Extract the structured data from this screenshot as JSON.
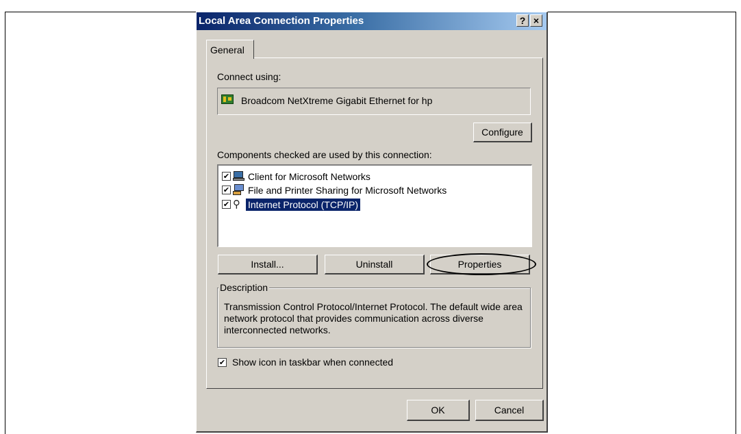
{
  "window": {
    "title": "Local Area Connection Properties",
    "help_label": "?",
    "close_label": "×"
  },
  "tabs": [
    {
      "label": "General",
      "selected": true
    }
  ],
  "connect_using": {
    "label": "Connect using:",
    "adapter": "Broadcom NetXtreme Gigabit Ethernet for hp",
    "configure_label": "Configure"
  },
  "components": {
    "label": "Components checked are used by this connection:",
    "items": [
      {
        "label": "Client for Microsoft Networks",
        "checked": true,
        "icon": "network-client-icon",
        "selected": false
      },
      {
        "label": "File and Printer Sharing for Microsoft Networks",
        "checked": true,
        "icon": "file-printer-sharing-icon",
        "selected": false
      },
      {
        "label": "Internet Protocol (TCP/IP)",
        "checked": true,
        "icon": "network-protocol-icon",
        "selected": true
      }
    ],
    "check_mark": "✔"
  },
  "actions": {
    "install_label": "Install...",
    "uninstall_label": "Uninstall",
    "properties_label": "Properties"
  },
  "description": {
    "legend": "Description",
    "text": "Transmission Control Protocol/Internet Protocol. The default wide area network protocol that provides communication across diverse interconnected networks."
  },
  "show_icon": {
    "label": "Show icon in taskbar when connected",
    "checked": true
  },
  "footer": {
    "ok_label": "OK",
    "cancel_label": "Cancel"
  },
  "colors": {
    "title_bar_start": "#0a246a",
    "dialog_face": "#d4d0c8",
    "selection": "#0a246a"
  }
}
